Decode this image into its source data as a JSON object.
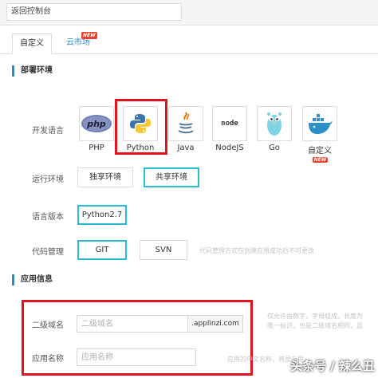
{
  "topbar": {
    "back_label": "返回控制台"
  },
  "tabs": [
    {
      "label": "自定义"
    },
    {
      "label": "云市场",
      "badge": "NEW"
    }
  ],
  "deploy": {
    "title": "部署环境",
    "language_label": "开发语言",
    "languages": [
      {
        "name": "PHP",
        "icon": "php-icon"
      },
      {
        "name": "Python",
        "icon": "python-icon"
      },
      {
        "name": "Java",
        "icon": "java-icon"
      },
      {
        "name": "NodeJS",
        "icon": "nodejs-icon",
        "logo_text": "node"
      },
      {
        "name": "Go",
        "icon": "go-gopher-icon"
      },
      {
        "name": "自定义",
        "icon": "docker-whale-icon",
        "badge": "NEW"
      }
    ],
    "runtime_label": "运行环境",
    "runtime_options": [
      "独享环境",
      "共享环境"
    ],
    "runtime_selected": "共享环境",
    "version_label": "语言版本",
    "version_value": "Python2.7",
    "code_label": "代码管理",
    "code_options": [
      "GIT",
      "SVN"
    ],
    "code_selected": "GIT",
    "code_hint": "代码管理方式在创建应用成功后不可更改"
  },
  "app_info": {
    "title": "应用信息",
    "subdomain_label": "二级域名",
    "subdomain_placeholder": "二级域名",
    "subdomain_suffix": ".applinzi.com",
    "subdomain_hint_1": "仅允许由数字，字母组成，长度为",
    "subdomain_hint_2": "唯一标识，也是二级域名相同，且",
    "name_label": "应用名称",
    "name_placeholder": "应用名称",
    "name_hint": "应用的中文名称，将显示用"
  },
  "watermark": "头条号 / 辣么丑",
  "colors": {
    "accent": "#2a8ad0",
    "selected_border": "#2bbcd4",
    "highlight_red": "#e0141e",
    "badge_red": "#e8412c"
  }
}
